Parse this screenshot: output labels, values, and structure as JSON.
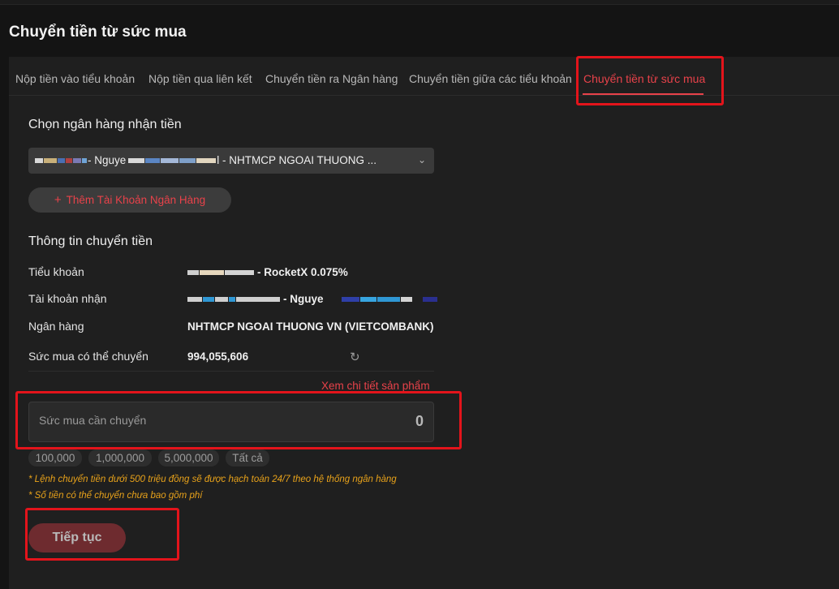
{
  "page_title": "Chuyển tiền từ sức mua",
  "tabs": [
    {
      "label": "Nộp tiền vào tiểu khoản"
    },
    {
      "label": "Nộp tiền qua liên kết"
    },
    {
      "label": "Chuyển tiền ra Ngân hàng"
    },
    {
      "label": "Chuyển tiền giữa các tiểu khoản"
    },
    {
      "label": "Chuyển tiền từ sức mua"
    }
  ],
  "bank": {
    "section_title": "Chọn ngân hàng nhận tiền",
    "selected_part1": "- Nguye",
    "selected_part2": "l - NHTMCP NGOAI THUONG ...",
    "add_button": "Thêm Tài Khoản Ngân Hàng"
  },
  "transfer_info": {
    "section_title": "Thông tin chuyển tiền",
    "rows": [
      {
        "label": "Tiểu khoản",
        "value": "- RocketX 0.075%"
      },
      {
        "label": "Tài khoản nhận",
        "value": "- Nguye"
      },
      {
        "label": "Ngân hàng",
        "value": "NHTMCP NGOAI THUONG VN (VIETCOMBANK)"
      },
      {
        "label": "Sức mua có thể chuyển",
        "value": "994,055,606"
      }
    ]
  },
  "detail_link": "Xem chi tiết sản phẩm",
  "amount": {
    "placeholder": "Sức mua cần chuyển",
    "value": "0"
  },
  "quick_amounts": [
    "100,000",
    "1,000,000",
    "5,000,000",
    "Tất cả"
  ],
  "notes": [
    "* Lệnh chuyển tiền dưới 500 triệu đồng sẽ được hạch toán 24/7 theo hệ thống ngân hàng",
    "* Số tiền có thể chuyển chưa bao gồm phí"
  ],
  "continue_button": "Tiếp tục",
  "colors": {
    "accent": "#e8424a",
    "highlight": "#e3141b",
    "note": "#e8a21a",
    "background": "#1f1f1f"
  },
  "icons": {
    "plus": "plus-icon",
    "dropdown": "chevron-down-icon",
    "refresh": "refresh-icon"
  }
}
